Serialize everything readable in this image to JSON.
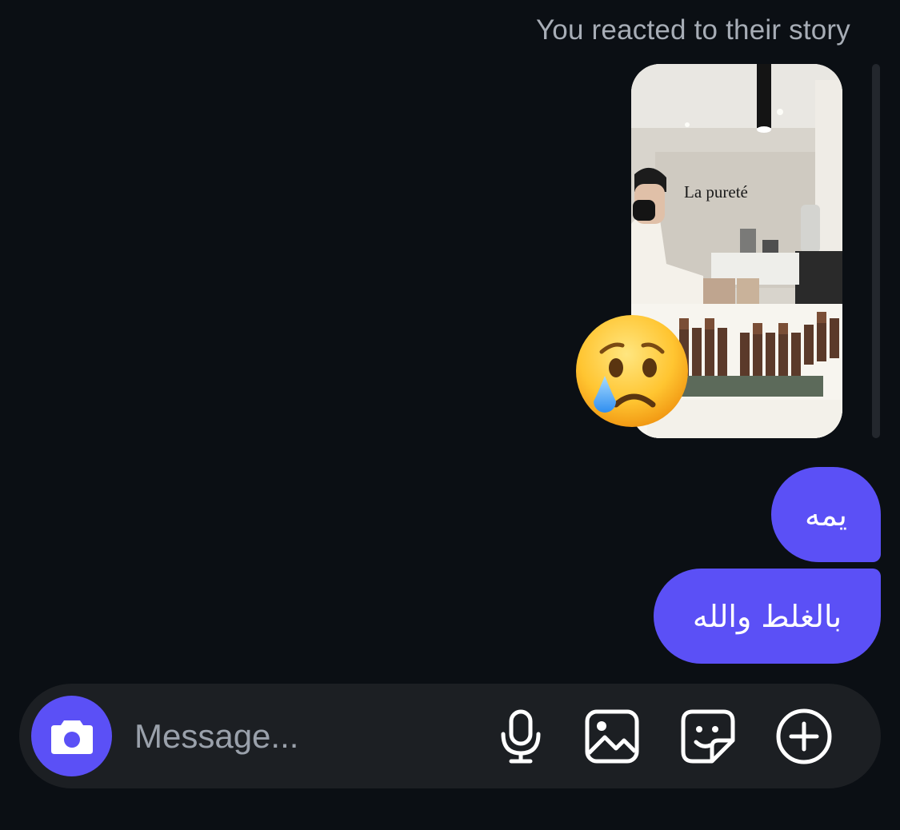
{
  "header": {
    "reaction_note": "You reacted to their story"
  },
  "story": {
    "sign_text": "La pureté",
    "reaction_icon": "crying-face-emoji"
  },
  "messages": [
    {
      "text": "يمه"
    },
    {
      "text": "بالغلط والله"
    }
  ],
  "composer": {
    "placeholder": "Message...",
    "icons": [
      "camera-icon",
      "microphone-icon",
      "gallery-icon",
      "sticker-icon",
      "plus-icon"
    ]
  },
  "colors": {
    "background": "#0b0f14",
    "bubble": "#5b50f6",
    "composer": "#1c1f23",
    "muted_text": "#a7adb6"
  }
}
